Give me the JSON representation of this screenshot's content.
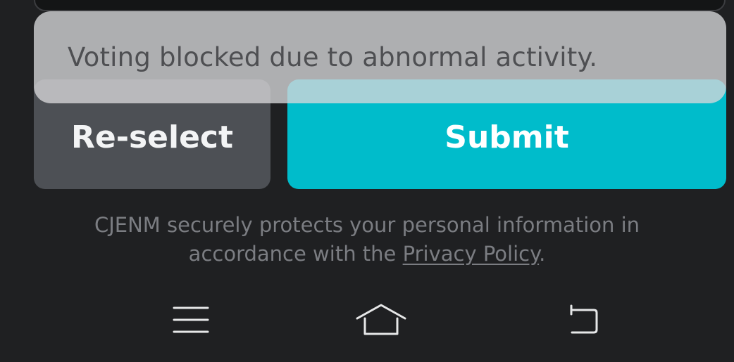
{
  "toast": {
    "message": "Voting blocked due to abnormal activity."
  },
  "actions": {
    "reselect_label": "Re-select",
    "submit_label": "Submit"
  },
  "footer": {
    "privacy_prefix_line1": "CJENM securely protects your personal information in",
    "privacy_prefix_line2": "accordance with the ",
    "privacy_link": "Privacy Policy",
    "privacy_suffix": "."
  },
  "navbar": {
    "items": [
      {
        "icon": "menu-icon"
      },
      {
        "icon": "home-icon"
      },
      {
        "icon": "back-icon"
      }
    ]
  },
  "colors": {
    "background": "#1f2022",
    "submit": "#00bccb",
    "reselect": "#4d5055",
    "toast": "#d7d7da"
  }
}
